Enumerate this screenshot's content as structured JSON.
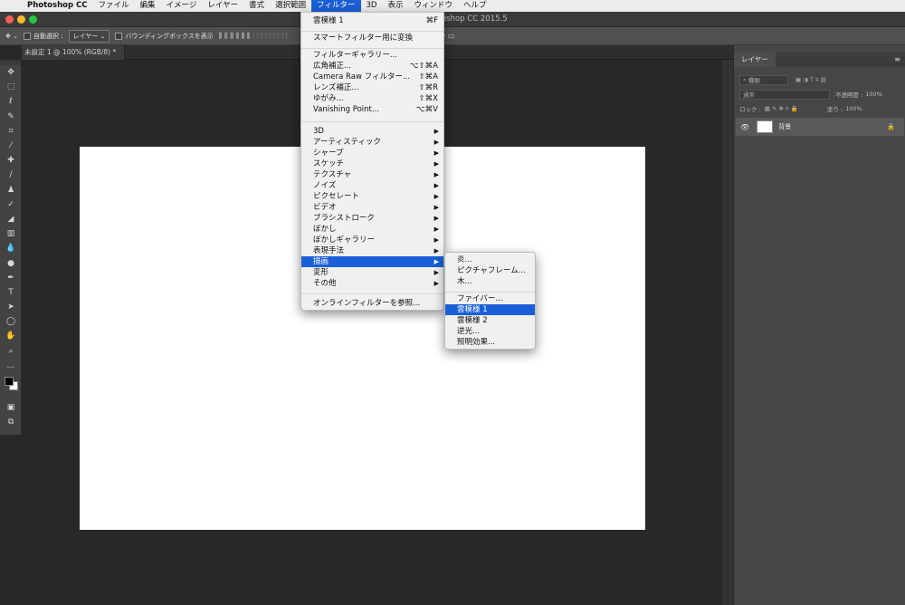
{
  "menubar": {
    "app": "Photoshop CC",
    "items": [
      "ファイル",
      "編集",
      "イメージ",
      "レイヤー",
      "書式",
      "選択範囲",
      "フィルター",
      "3D",
      "表示",
      "ウィンドウ",
      "ヘルプ"
    ],
    "active": "フィルター"
  },
  "window": {
    "title": "Adobe Photoshop CC 2015.5"
  },
  "options": {
    "auto_select": "自動選択 :",
    "target": "レイヤー",
    "bounding_box": "バウンディングボックスを表示"
  },
  "document": {
    "tab": "未設定 1 @ 100% (RGB/8) *"
  },
  "layers_panel": {
    "tab": "レイヤー",
    "kind": "種類",
    "blend": "通常",
    "opacity_label": "不透明度 :",
    "opacity": "100%",
    "lock_label": "ロック :",
    "fill_label": "塗り :",
    "fill": "100%",
    "layer_name": "背景"
  },
  "filter_menu": {
    "items": [
      {
        "label": "雲模様 1",
        "shortcut": "⌘F"
      },
      {
        "label": "スマートフィルター用に変換"
      },
      {
        "label": "フィルターギャラリー..."
      },
      {
        "label": "広角補正...",
        "shortcut": "⌥⇧⌘A"
      },
      {
        "label": "Camera Raw フィルター...",
        "shortcut": "⇧⌘A"
      },
      {
        "label": "レンズ補正...",
        "shortcut": "⇧⌘R"
      },
      {
        "label": "ゆがみ...",
        "shortcut": "⇧⌘X"
      },
      {
        "label": "Vanishing Point...",
        "shortcut": "⌥⌘V"
      },
      {
        "label": "3D"
      },
      {
        "label": "アーティスティック"
      },
      {
        "label": "シャープ"
      },
      {
        "label": "スケッチ"
      },
      {
        "label": "テクスチャ"
      },
      {
        "label": "ノイズ"
      },
      {
        "label": "ピクセレート"
      },
      {
        "label": "ビデオ"
      },
      {
        "label": "ブラシストローク"
      },
      {
        "label": "ぼかし"
      },
      {
        "label": "ぼかしギャラリー"
      },
      {
        "label": "表現手法"
      },
      {
        "label": "描画"
      },
      {
        "label": "変形"
      },
      {
        "label": "その他"
      },
      {
        "label": "オンラインフィルターを参照..."
      }
    ]
  },
  "render_submenu": {
    "items": [
      {
        "label": "炎..."
      },
      {
        "label": "ピクチャフレーム..."
      },
      {
        "label": "木..."
      },
      {
        "label": "ファイバー..."
      },
      {
        "label": "雲模様 1"
      },
      {
        "label": "雲模様 2"
      },
      {
        "label": "逆光..."
      },
      {
        "label": "照明効果..."
      }
    ]
  },
  "colors": {
    "highlight": "#1a5fd6",
    "canvas": "#ffffff",
    "workspace": "#282828"
  }
}
